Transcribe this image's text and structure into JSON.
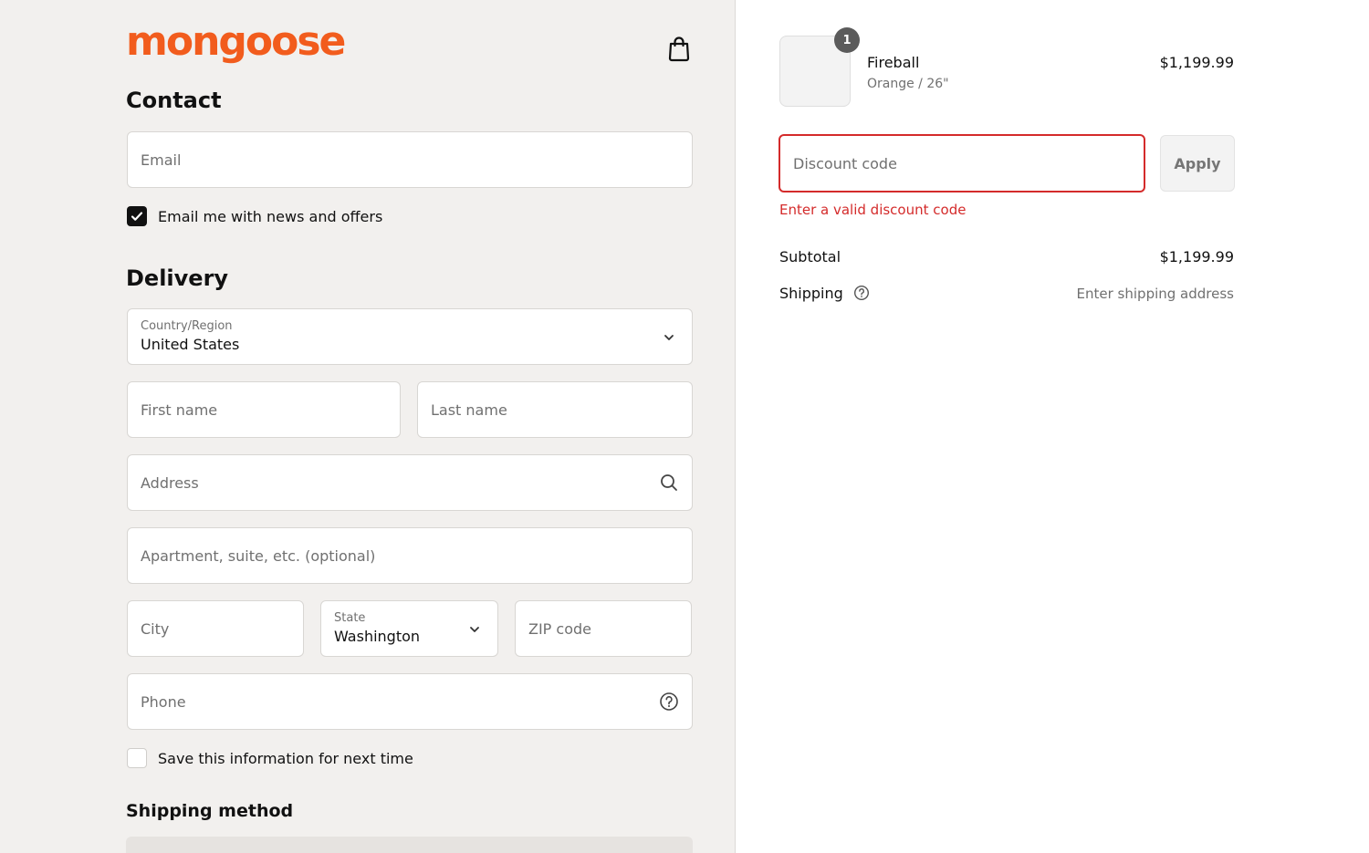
{
  "brand": {
    "logo_text": "mongoose",
    "accent": "#f25c1d"
  },
  "contact": {
    "heading": "Contact",
    "email_placeholder": "Email",
    "newsletter_label": "Email me with news and offers",
    "newsletter_checked": true
  },
  "delivery": {
    "heading": "Delivery",
    "country_label": "Country/Region",
    "country_value": "United States",
    "first_name_placeholder": "First name",
    "last_name_placeholder": "Last name",
    "address_placeholder": "Address",
    "apartment_placeholder": "Apartment, suite, etc. (optional)",
    "city_placeholder": "City",
    "state_label": "State",
    "state_value": "Washington",
    "zip_placeholder": "ZIP code",
    "phone_placeholder": "Phone",
    "save_label": "Save this information for next time",
    "save_checked": false
  },
  "shipping_method": {
    "heading": "Shipping method"
  },
  "order": {
    "item": {
      "quantity": "1",
      "name": "Fireball",
      "variant": "Orange / 26\"",
      "price": "$1,199.99"
    },
    "discount_placeholder": "Discount code",
    "apply_label": "Apply",
    "discount_error": "Enter a valid discount code",
    "subtotal_label": "Subtotal",
    "subtotal_value": "$1,199.99",
    "shipping_label": "Shipping",
    "shipping_value": "Enter shipping address",
    "error_color": "#d42b2b"
  },
  "icons": [
    "shopping-bag-icon",
    "checkmark-icon",
    "chevron-down-icon",
    "search-icon",
    "help-icon"
  ]
}
